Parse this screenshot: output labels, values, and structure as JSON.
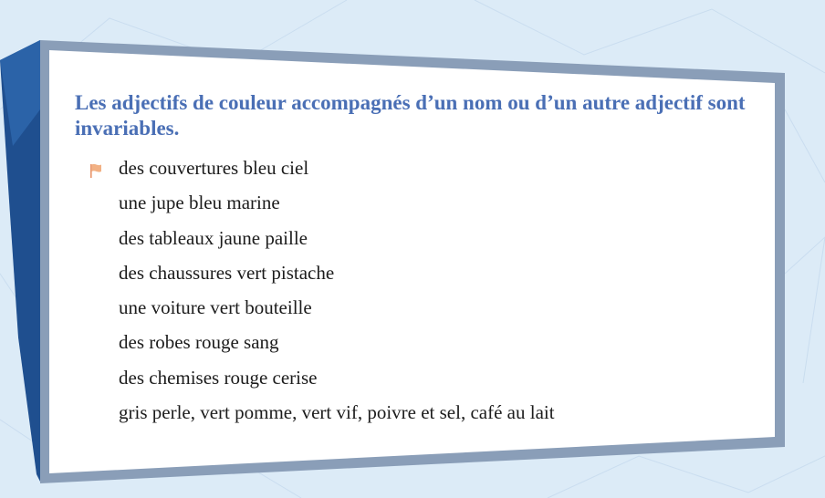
{
  "slide": {
    "title": "Les adjectifs de couleur accompagnés d’un nom ou d’un autre adjectif sont invariables.",
    "examples": [
      "des couvertures bleu ciel",
      "une jupe bleu marine",
      "des tableaux jaune paille",
      "des chaussures vert pistache",
      "une voiture vert bouteille",
      "des robes rouge sang",
      "des chemises rouge cerise",
      "gris perle, vert pomme, vert vif, poivre et sel, café au lait"
    ],
    "bullet_icon": "flag-icon"
  },
  "colors": {
    "background": "#dcebf7",
    "frame_border": "#8a9eb8",
    "frame_side": "#1f4f8f",
    "title": "#4a6fb5",
    "text": "#1c1c1c",
    "bullet": "#f0a46a"
  }
}
